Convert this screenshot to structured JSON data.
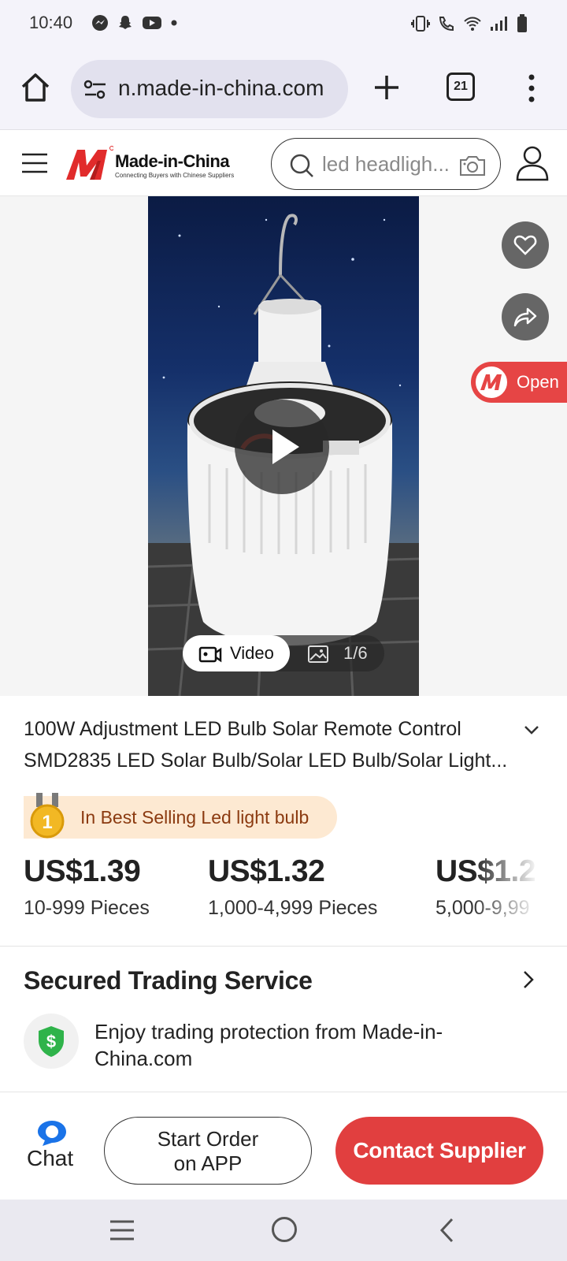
{
  "status_bar": {
    "time": "10:40",
    "left_icons": [
      "messenger-icon",
      "snapchat-icon",
      "youtube-icon",
      "dot-icon"
    ],
    "right_icons": [
      "vibrate-icon",
      "wifi-call-icon",
      "wifi-icon",
      "signal-icon",
      "battery-icon"
    ]
  },
  "browser": {
    "url": "n.made-in-china.com",
    "tab_count": "21"
  },
  "site_header": {
    "logo_title": "Made-in-China",
    "logo_subtitle": "Connecting Buyers with Chinese Suppliers",
    "search_placeholder": "led headligh..."
  },
  "gallery": {
    "video_label": "Video",
    "image_count": "1/6",
    "open_label": "Open"
  },
  "product": {
    "title_line1": "100W Adjustment LED Bulb Solar Remote Control",
    "title_line2": "SMD2835 LED Solar Bulb/Solar LED Bulb/Solar Light...",
    "best_selling": "In Best Selling Led light bulb",
    "rank_badge": "1",
    "price_tiers": [
      {
        "price": "US$1.39",
        "qty": "10-999  Pieces"
      },
      {
        "price": "US$1.32",
        "qty": "1,000-4,999  Pieces"
      },
      {
        "price": "US$1.2",
        "qty": "5,000-9,99"
      }
    ]
  },
  "secured": {
    "title": "Secured Trading Service",
    "description": "Enjoy trading protection from Made-in-China.com"
  },
  "actions": {
    "chat_label": "Chat",
    "start_order_line1": "Start Order",
    "start_order_line2": "on APP",
    "contact_label": "Contact Supplier"
  },
  "colors": {
    "accent_red": "#e13f3f",
    "badge_bg": "#fde9d2",
    "chat_blue": "#1a73e8",
    "shield_green": "#2fb34a"
  }
}
